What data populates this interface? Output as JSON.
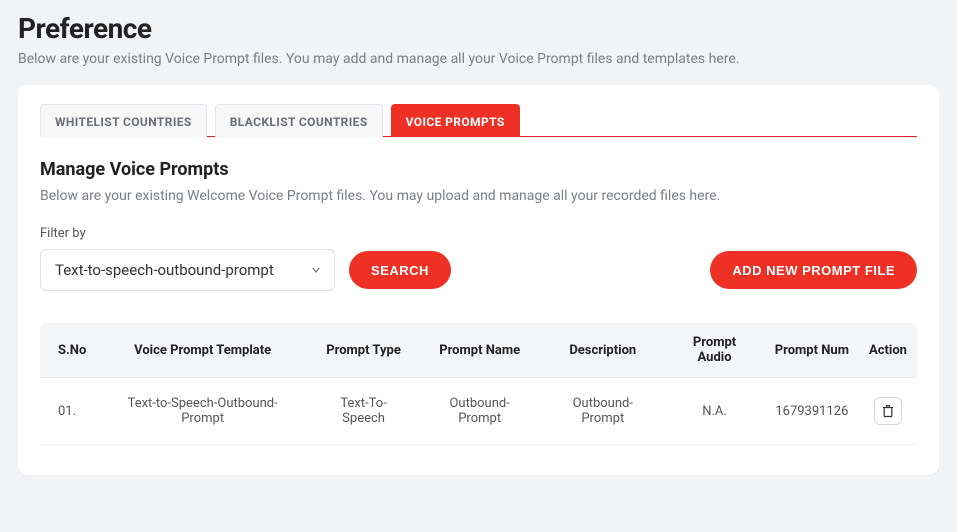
{
  "page": {
    "title": "Preference",
    "subtitle": "Below are your existing Voice Prompt files. You may add and manage all your Voice Prompt files and templates here."
  },
  "tabs": {
    "whitelist": "WHITELIST COUNTRIES",
    "blacklist": "BLACKLIST COUNTRIES",
    "voice": "VOICE PROMPTS"
  },
  "section": {
    "title": "Manage Voice Prompts",
    "subtitle": "Below are your existing Welcome Voice Prompt files. You may upload and manage all your recorded files here."
  },
  "filter": {
    "label": "Filter by",
    "selected": "Text-to-speech-outbound-prompt"
  },
  "buttons": {
    "search": "SEARCH",
    "add": "ADD NEW PROMPT FILE"
  },
  "table": {
    "headers": {
      "sno": "S.No",
      "template": "Voice Prompt Template",
      "type": "Prompt Type",
      "name": "Prompt Name",
      "desc": "Description",
      "audio": "Prompt Audio",
      "num": "Prompt Num",
      "action": "Action"
    },
    "rows": [
      {
        "sno": "01.",
        "template": "Text-to-Speech-Outbound-Prompt",
        "type": "Text-To-Speech",
        "name": "Outbound-Prompt",
        "desc": "Outbound-Prompt",
        "audio": "N.A.",
        "num": "1679391126"
      }
    ]
  }
}
